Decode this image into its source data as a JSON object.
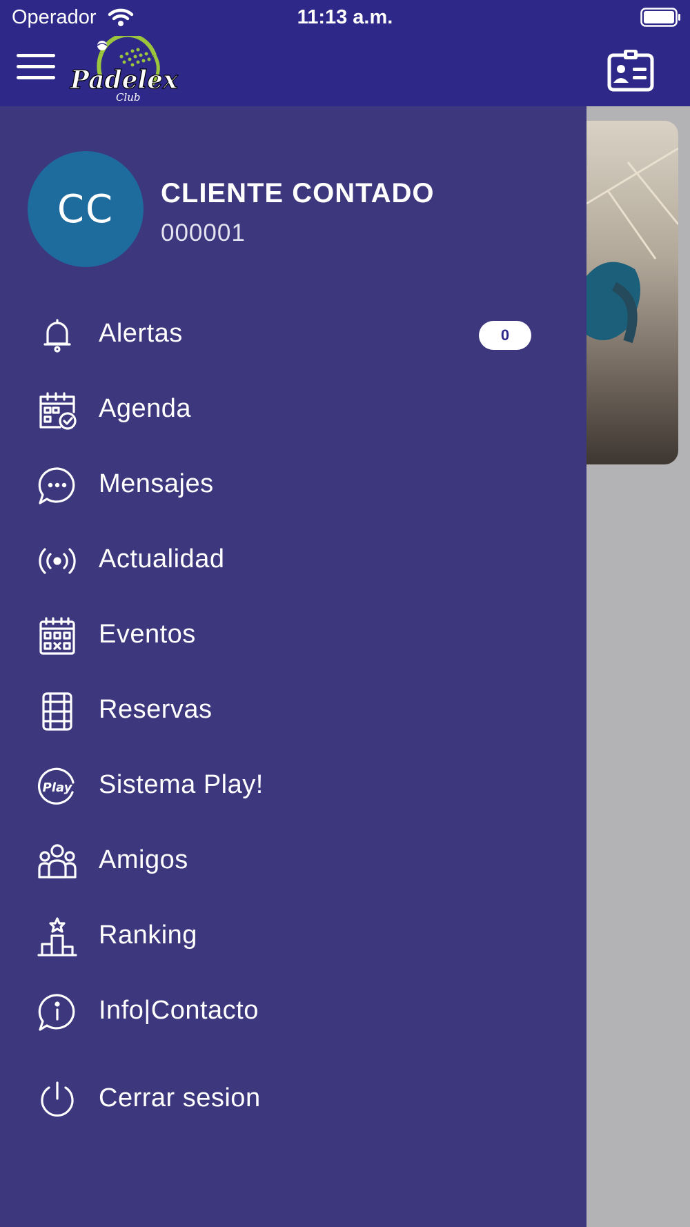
{
  "status_bar": {
    "carrier": "Operador",
    "time": "11:13 a.m."
  },
  "app_bar": {
    "logo_text": "Padelex",
    "logo_subtext": "Club"
  },
  "profile": {
    "initials": "CC",
    "name": "CLIENTE CONTADO",
    "id": "000001"
  },
  "menu": {
    "items": [
      {
        "label": "Alertas",
        "icon": "bell-icon",
        "badge": "0"
      },
      {
        "label": "Agenda",
        "icon": "calendar-check-icon"
      },
      {
        "label": "Mensajes",
        "icon": "chat-bubble-icon"
      },
      {
        "label": "Actualidad",
        "icon": "broadcast-icon"
      },
      {
        "label": "Eventos",
        "icon": "calendar-grid-icon"
      },
      {
        "label": "Reservas",
        "icon": "court-icon"
      },
      {
        "label": "Sistema Play!",
        "icon": "play-badge-icon"
      },
      {
        "label": "Amigos",
        "icon": "friends-icon"
      },
      {
        "label": "Ranking",
        "icon": "podium-icon"
      },
      {
        "label": "Info|Contacto",
        "icon": "info-bubble-icon"
      },
      {
        "label": "Cerrar sesion",
        "icon": "power-icon"
      }
    ]
  },
  "colors": {
    "header": "#2e2989",
    "drawer": "#3d377d",
    "avatar": "#1e6b9e",
    "logo_accent": "#9bc53d"
  }
}
